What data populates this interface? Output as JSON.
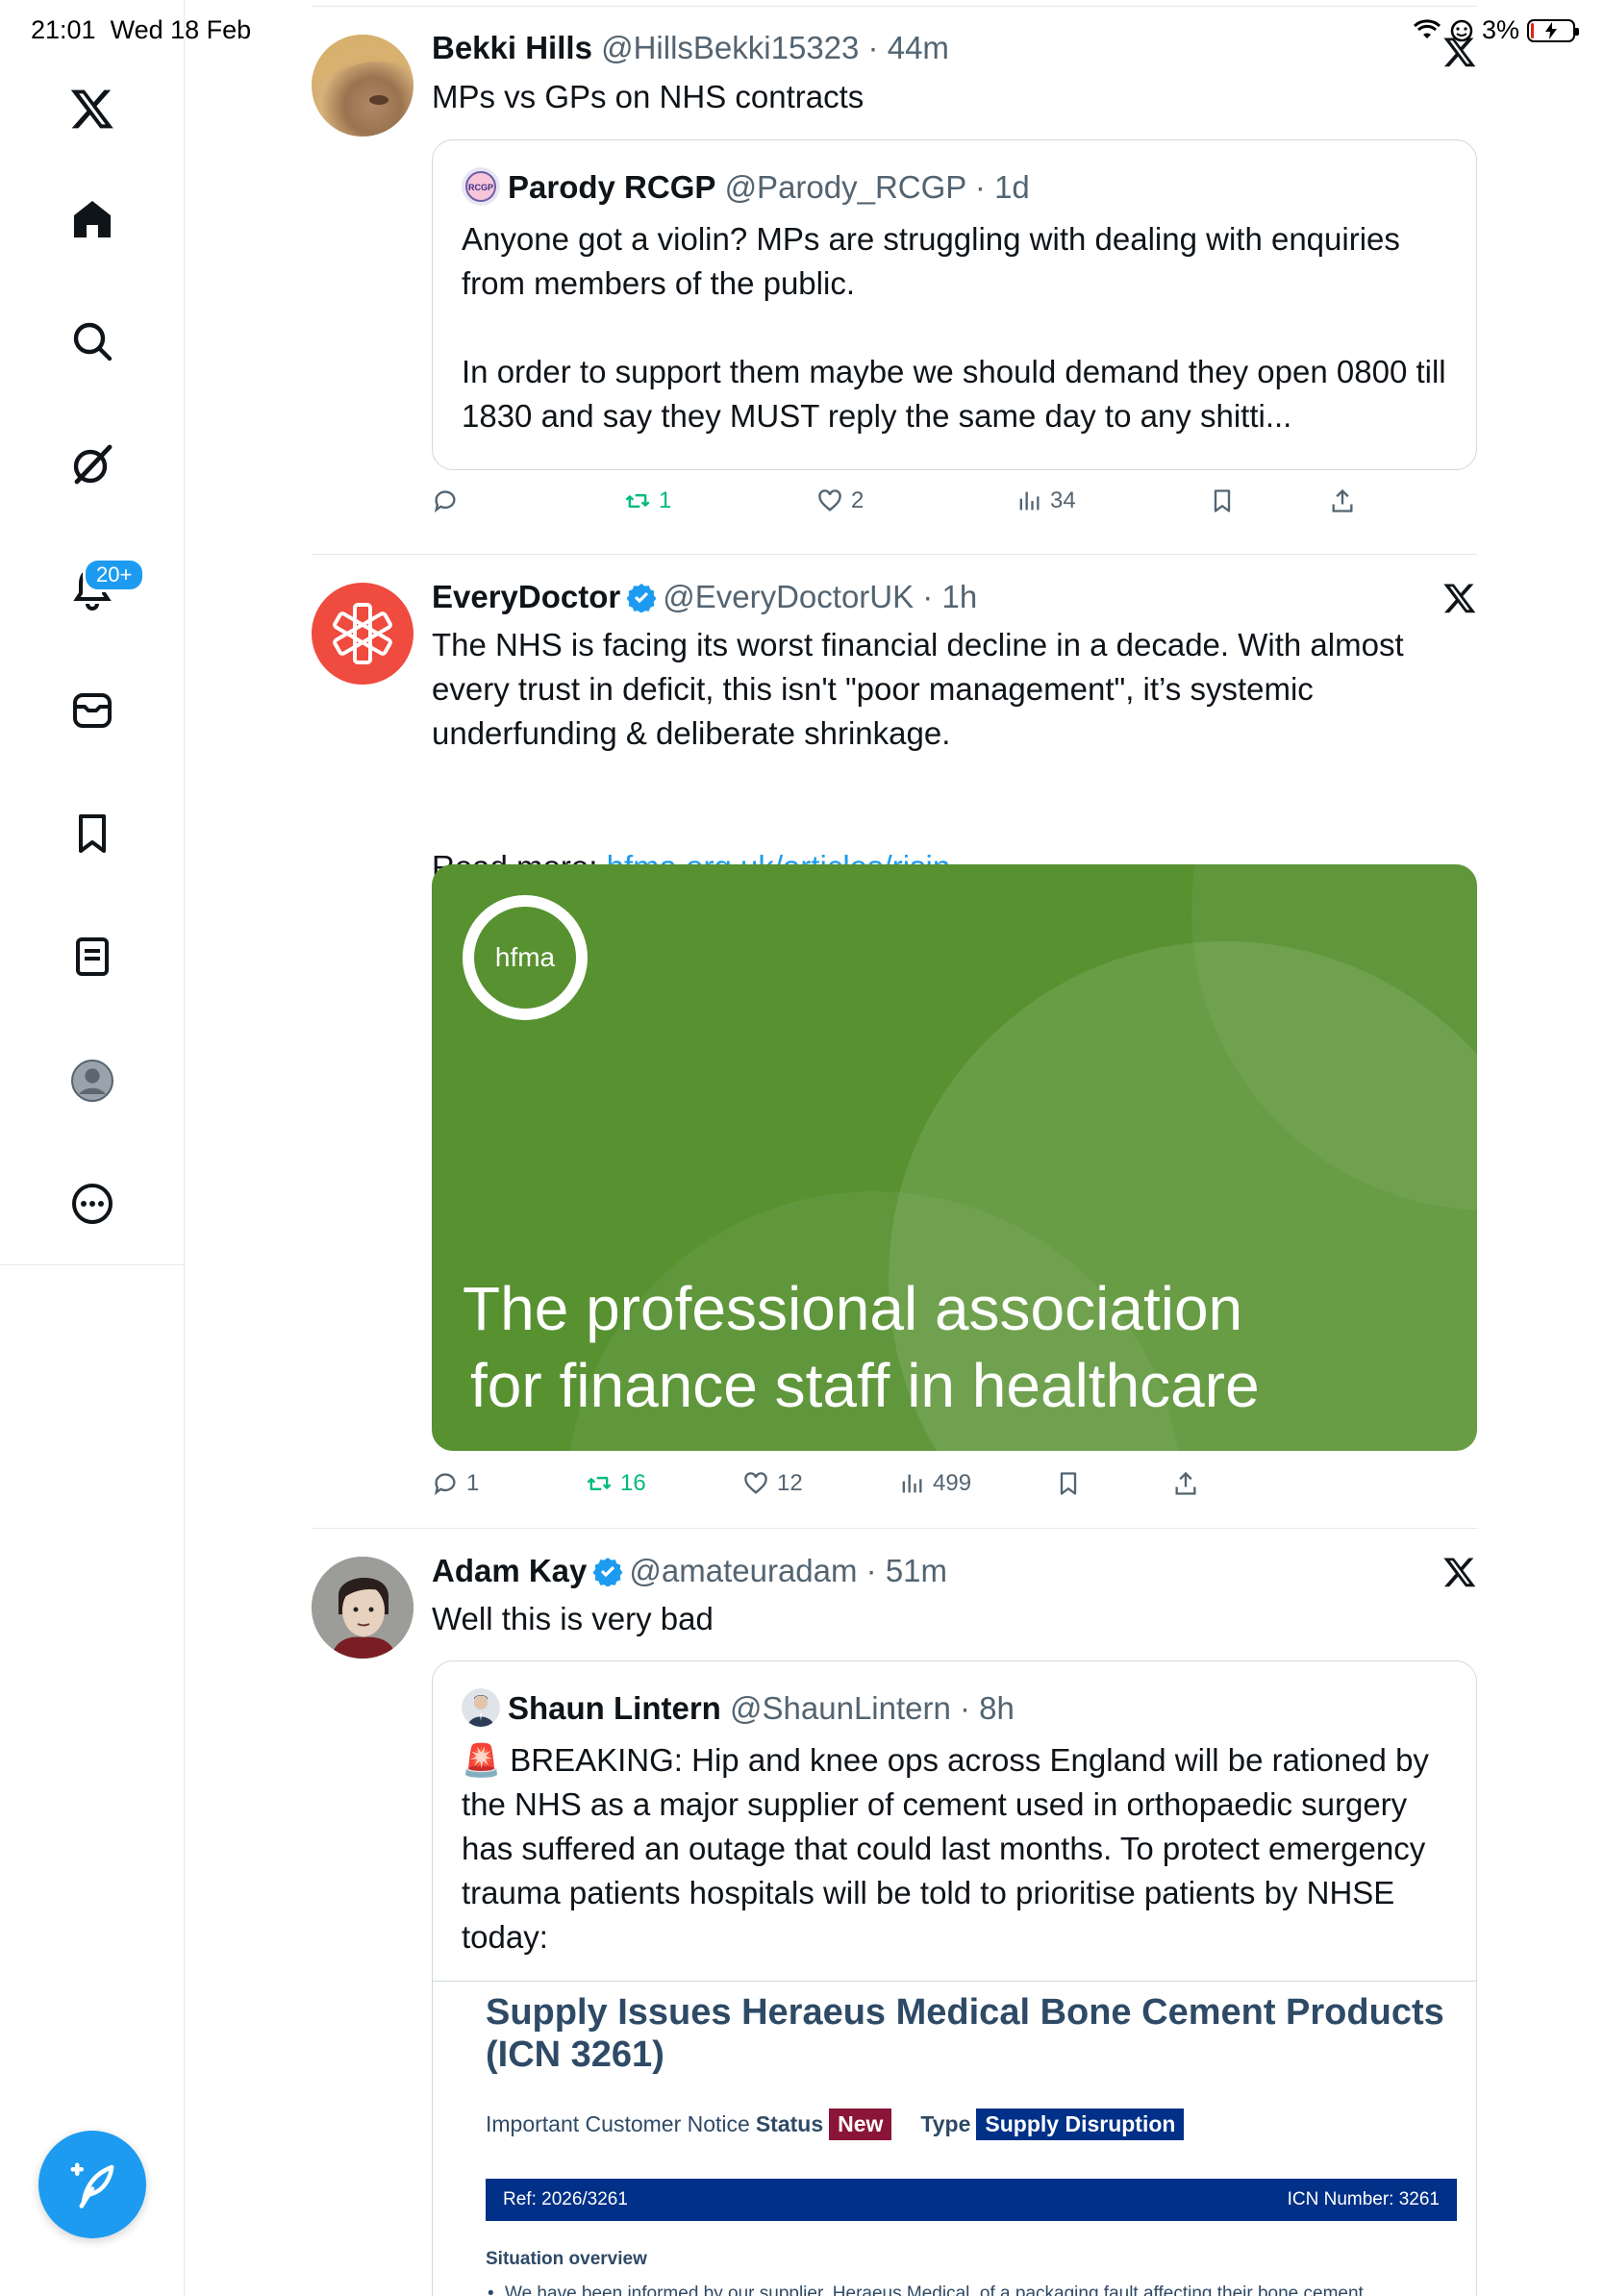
{
  "status_bar": {
    "time": "21:01",
    "date": "Wed 18 Feb",
    "battery": "3%"
  },
  "sidebar": {
    "notifications_badge": "20+",
    "items": [
      "x-logo",
      "home",
      "explore",
      "grok",
      "notifications",
      "messages",
      "bookmarks",
      "lists",
      "profile",
      "more"
    ]
  },
  "tweets": [
    {
      "name": "Bekki Hills",
      "handle": "@HillsBekki15323",
      "sep": " · ",
      "time": "44m",
      "text": "MPs vs GPs on NHS contracts",
      "quote": {
        "name": "Parody RCGP",
        "handle": "@Parody_RCGP",
        "sep": " · ",
        "time": "1d",
        "avatar_text": "RCGP",
        "text": "Anyone got a violin? MPs are struggling with dealing with enquiries from members of the public.\n\nIn order to support them maybe we should demand they open 0800 till 1830 and say they MUST reply the same day to any shitti..."
      },
      "stats": {
        "replies": "",
        "reposts": "1",
        "likes": "2",
        "views": "34"
      }
    },
    {
      "name": "EveryDoctor",
      "handle": "@EveryDoctorUK",
      "sep": " · ",
      "time": "1h",
      "text": "The NHS is facing its worst financial decline in a decade. With almost every trust in deficit, this isn't \"poor management\", it’s systemic underfunding & deliberate shrinkage.",
      "read_more_label": "Read more: ",
      "link": "hfma.org.uk/articles/risin...",
      "card": {
        "logo_text": "hfma",
        "line1": "The professional association",
        "line2": "for finance staff in healthcare",
        "color": "#579130"
      },
      "stats": {
        "replies": "1",
        "reposts": "16",
        "likes": "12",
        "views": "499"
      }
    },
    {
      "name": "Adam Kay",
      "handle": "@amateuradam",
      "sep": " · ",
      "time": "51m",
      "text": "Well this is very bad",
      "quote": {
        "name": "Shaun Lintern",
        "handle": "@ShaunLintern",
        "sep": " · ",
        "time": "8h",
        "text": "🚨 BREAKING: Hip and knee ops across England will be rationed by the NHS as a major supplier of cement used in orthopaedic surgery has suffered an outage that could last months. To protect emergency trauma patients hospitals will be told to prioritise patients by NHSE today:",
        "document": {
          "title": "Supply Issues Heraeus Medical Bone Cement Products (ICN 3261)",
          "notice_label": "Important Customer Notice",
          "status_label": "Status",
          "status_value": "New",
          "type_label": "Type",
          "type_value": "Supply Disruption",
          "ref": "Ref: 2026/3261",
          "icn_number": "ICN Number: 3261",
          "section": "Situation overview",
          "bullet": "We have been informed by our supplier, Heraeus Medical, of a packaging fault affecting their bone cement products. This issue has temporarily halted production at their main site and will impact product availability for at"
        }
      }
    }
  ],
  "colors": {
    "accent": "#1d9bf0",
    "repost_green": "#00ba7c",
    "text": "#0f1419",
    "muted": "#536471",
    "everydoctor_red": "#ef4b3f"
  }
}
